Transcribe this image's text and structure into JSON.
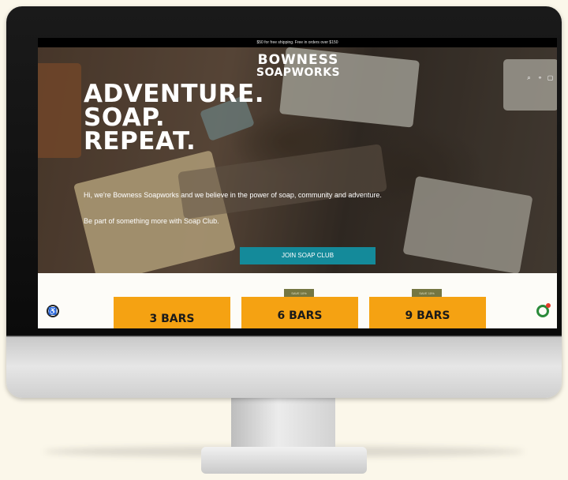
{
  "announcement": "$50 for free shipping. Free in orders over $150",
  "brand": {
    "line1": "BOWNESS",
    "line2": "SOAPWORKS"
  },
  "hero": {
    "headline": [
      "ADVENTURE.",
      "SOAP.",
      "REPEAT."
    ],
    "intro": "Hi, we're Bowness Soapworks and we believe in the power of soap, community and adventure.",
    "soap_club_text": "Be part of something more with Soap Club.",
    "button_label": "JOIN SOAP CLUB"
  },
  "header_icons": [
    "search-icon",
    "account-icon",
    "cart-icon"
  ],
  "offers": [
    {
      "label": "3 BARS",
      "tag": ""
    },
    {
      "label": "6 BARS",
      "tag": "SAVE 10%"
    },
    {
      "label": "9 BARS",
      "tag": "SAVE 15%"
    }
  ],
  "accessibility_icon": "accessibility-icon",
  "colors": {
    "accent_teal": "#148a9a",
    "offer_orange": "#f5a212",
    "tag_olive": "#747642"
  }
}
